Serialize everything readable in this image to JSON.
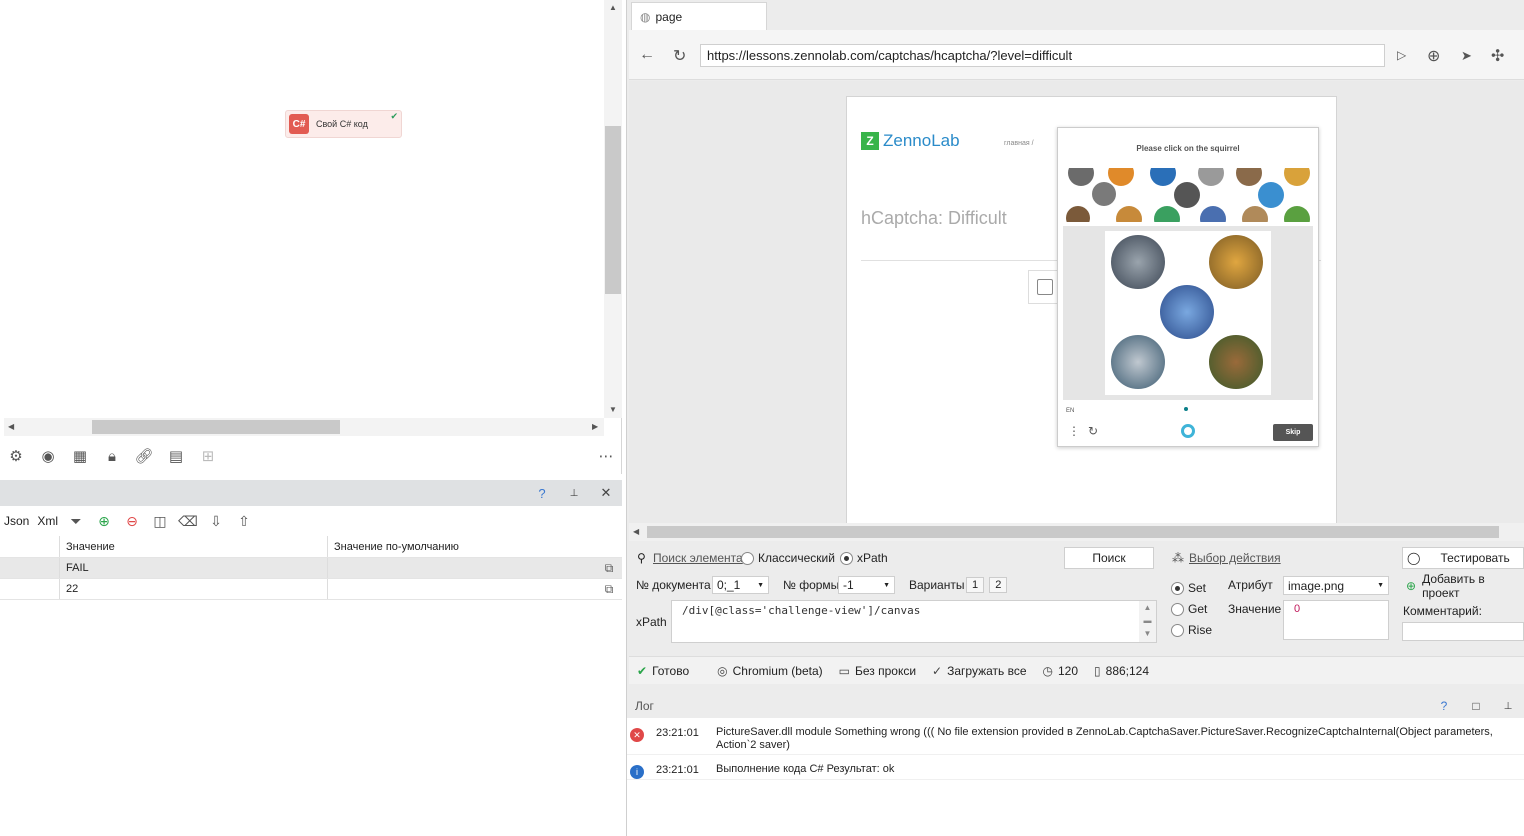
{
  "canvas": {
    "node": {
      "badge": "C#",
      "label": "Свой C# код"
    }
  },
  "variables": {
    "toolbar": {
      "json": "Json",
      "xml": "Xml"
    },
    "header_icons": {
      "help": "?",
      "pin": "📌",
      "close": "✕"
    },
    "columns": [
      "Значение",
      "Значение по-умолчанию"
    ],
    "rows": [
      {
        "value": "FAIL",
        "default": ""
      },
      {
        "value": "22",
        "default": ""
      }
    ]
  },
  "browser": {
    "tab": "page",
    "url": "https://lessons.zennolab.com/captchas/hcaptcha/?level=difficult",
    "page": {
      "logo": "ZennoLab",
      "nav": "главная   /",
      "title": "hCaptcha: Difficult",
      "captcha": {
        "question": "Please click on the squirrel",
        "lang": "EN",
        "skip": "Skip"
      }
    }
  },
  "search": {
    "find_element": "Поиск элемента",
    "classic": "Классический",
    "xpath_radio": "xPath",
    "search_btn": "Поиск",
    "choose_action": "Выбор действия",
    "test_btn": "Тестировать",
    "add_project": "Добавить в проект",
    "doc_label": "№ документа",
    "doc_value": "0;_1",
    "form_label": "№ формы",
    "form_value": "-1",
    "variants_label": "Варианты",
    "variants": [
      "1",
      "2"
    ],
    "set": "Set",
    "get": "Get",
    "rise": "Rise",
    "attr_label": "Атрибут",
    "attr_value": "image.png",
    "value_label": "Значение",
    "value_value": "0",
    "comment_label": "Комментарий:",
    "xpath_label": "xPath",
    "xpath_value": "/div[@class='challenge-view']/canvas"
  },
  "status": {
    "ready": "Готово",
    "browser": "Chromium (beta)",
    "proxy": "Без прокси",
    "load_all": "Загружать все",
    "timeout": "120",
    "coords": "886;124"
  },
  "log": {
    "title": "Лог",
    "entries": [
      {
        "type": "error",
        "time": "23:21:01",
        "message": "PictureSaver.dll module Something wrong ((( No file extension provided   в ZennoLab.CaptchaSaver.PictureSaver.RecognizeCaptchaInternal(Object parameters, Action`2 saver)"
      },
      {
        "type": "info",
        "time": "23:21:01",
        "message": "Выполнение кода C#  Результат: ok"
      }
    ]
  }
}
